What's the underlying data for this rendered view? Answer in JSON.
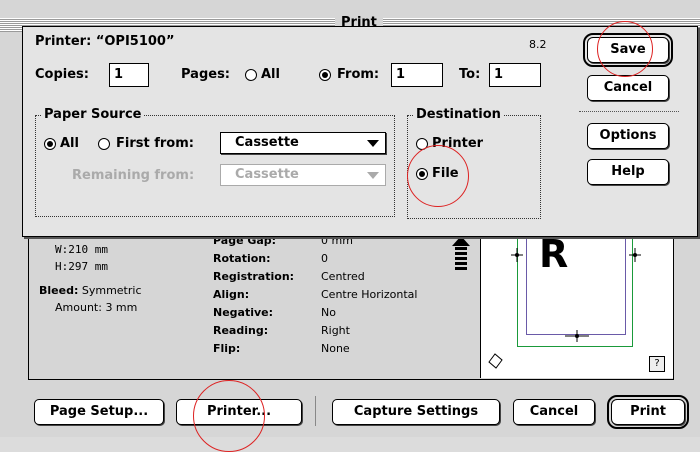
{
  "background_window": {
    "title": "Print",
    "size": {
      "w": "W:210  mm",
      "h": "H:297  mm"
    },
    "bleed": {
      "label": "Bleed:",
      "value": "Symmetric",
      "amount_label": "Amount:",
      "amount_value": "3  mm"
    },
    "info": [
      {
        "key": "Page Gap:",
        "value": "0  mm"
      },
      {
        "key": "Rotation:",
        "value": "0"
      },
      {
        "key": "Registration:",
        "value": "Centred"
      },
      {
        "key": "Align:",
        "value": "Centre Horizontal"
      },
      {
        "key": "Negative:",
        "value": "No"
      },
      {
        "key": "Reading:",
        "value": "Right"
      },
      {
        "key": "Flip:",
        "value": "None"
      }
    ],
    "preview_letter": "R",
    "help_glyph": "?",
    "buttons": {
      "page_setup": "Page Setup...",
      "printer": "Printer...",
      "capture_settings": "Capture Settings",
      "cancel": "Cancel",
      "print": "Print"
    }
  },
  "dialog": {
    "printer_label": "Printer:",
    "printer_name": "“OPI5100”",
    "version": "8.2",
    "copies_label": "Copies:",
    "copies_value": "1",
    "pages_label": "Pages:",
    "pages_all": "All",
    "pages_from": "From:",
    "from_value": "1",
    "to_label": "To:",
    "to_value": "1",
    "paper_source": {
      "title": "Paper Source",
      "all": "All",
      "first_from": "First from:",
      "first_from_value": "Cassette",
      "remaining_from": "Remaining from:",
      "remaining_value": "Cassette"
    },
    "destination": {
      "title": "Destination",
      "printer": "Printer",
      "file": "File",
      "selected": "File"
    },
    "buttons": {
      "save": "Save",
      "cancel": "Cancel",
      "options": "Options",
      "help": "Help"
    }
  },
  "colors": {
    "annotation": "#dd2222",
    "preview_green": "#1a9a3a",
    "preview_purple": "#6a5aa8"
  }
}
